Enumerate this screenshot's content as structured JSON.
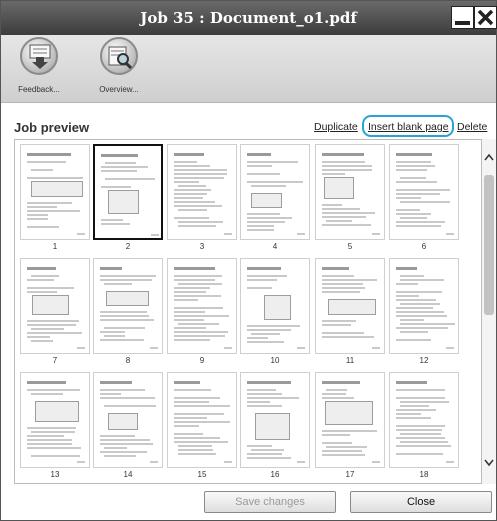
{
  "window": {
    "title": "Job 35 : Document_o1.pdf"
  },
  "toolbar": {
    "items": [
      {
        "label": "Feedback...",
        "icon": "feedback-icon"
      },
      {
        "label": "Overview...",
        "icon": "overview-icon"
      }
    ]
  },
  "preview": {
    "title": "Job preview",
    "actions": {
      "duplicate": "Duplicate",
      "insert_blank": "Insert blank page",
      "delete": "Delete"
    },
    "selected_page": "2",
    "pages": [
      "1",
      "2",
      "3",
      "4",
      "5",
      "6",
      "7",
      "8",
      "9",
      "10",
      "11",
      "12",
      "13",
      "14",
      "15",
      "16",
      "17",
      "18"
    ]
  },
  "footer": {
    "save": "Save changes",
    "close": "Close"
  },
  "colors": {
    "highlight": "#2aa2d6",
    "titlebar": "#4a4a4a"
  }
}
